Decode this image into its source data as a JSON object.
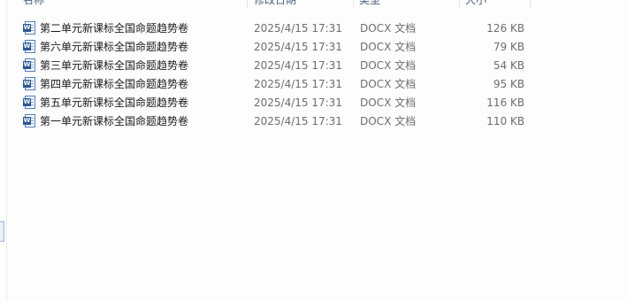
{
  "columns": {
    "name": "名称",
    "date": "修改日期",
    "type": "类型",
    "size": "大小"
  },
  "icon": {
    "file_icon": "word-document-icon",
    "badge_letter": "W",
    "accent": "#2b5797"
  },
  "files": [
    {
      "name": "第二单元新课标全国命题趋势卷",
      "date": "2025/4/15 17:31",
      "type": "DOCX 文档",
      "size": "126 KB"
    },
    {
      "name": "第六单元新课标全国命题趋势卷",
      "date": "2025/4/15 17:31",
      "type": "DOCX 文档",
      "size": "79 KB"
    },
    {
      "name": "第三单元新课标全国命题趋势卷",
      "date": "2025/4/15 17:31",
      "type": "DOCX 文档",
      "size": "54 KB"
    },
    {
      "name": "第四单元新课标全国命题趋势卷",
      "date": "2025/4/15 17:31",
      "type": "DOCX 文档",
      "size": "95 KB"
    },
    {
      "name": "第五单元新课标全国命题趋势卷",
      "date": "2025/4/15 17:31",
      "type": "DOCX 文档",
      "size": "116 KB"
    },
    {
      "name": "第一单元新课标全国命题趋势卷",
      "date": "2025/4/15 17:31",
      "type": "DOCX 文档",
      "size": "110 KB"
    }
  ]
}
